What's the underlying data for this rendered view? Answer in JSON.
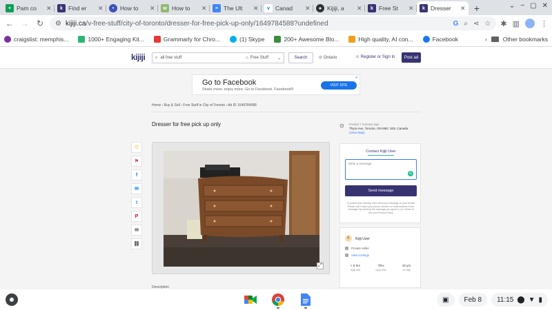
{
  "browser": {
    "tabs": [
      {
        "title": "Pam co",
        "icon": "google-sheets-icon",
        "color": "#0f9d58",
        "glyph": "+"
      },
      {
        "title": "Find er",
        "icon": "kijiji-icon",
        "color": "#373373",
        "glyph": "k"
      },
      {
        "title": "How to",
        "icon": "globe-icon",
        "color": "#4051b5",
        "glyph": "•"
      },
      {
        "title": "How to",
        "icon": "wikihow-icon",
        "color": "#93b874",
        "glyph": "w"
      },
      {
        "title": "The Ult",
        "icon": "google-docs-icon",
        "color": "#4285f4",
        "glyph": "≡"
      },
      {
        "title": "Canad",
        "icon": "vmedia-icon",
        "color": "#1a73e8",
        "glyph": "v"
      },
      {
        "title": "Kijiji, a",
        "icon": "github-icon",
        "color": "#333333",
        "glyph": "●"
      },
      {
        "title": "Free St",
        "icon": "kijiji-icon",
        "color": "#373373",
        "glyph": "k"
      },
      {
        "title": "Dresser",
        "icon": "kijiji-icon",
        "color": "#373373",
        "glyph": "k",
        "active": true
      }
    ],
    "url_host": "kijiji.ca",
    "url_path": "/v-free-stuff/city-of-toronto/dresser-for-free-pick-up-only/1649784588?undefined",
    "bookmarks": [
      {
        "label": "craigslist: memphis...",
        "icon": "craigslist-icon",
        "color": "#7b2fa1"
      },
      {
        "label": "1000+ Engaging Kit...",
        "icon": "bookmark-icon",
        "color": "#2bb673"
      },
      {
        "label": "Grammarly for Chro...",
        "icon": "grammarly-icon",
        "color": "#e53935"
      },
      {
        "label": "(1) Skype",
        "icon": "skype-icon",
        "color": "#00aff0"
      },
      {
        "label": "200+ Awesome Blo...",
        "icon": "bookmark-icon",
        "color": "#3d8c40"
      },
      {
        "label": "High quality, AI con...",
        "icon": "bookmark-icon",
        "color": "#f0a020"
      },
      {
        "label": "Facebook",
        "icon": "facebook-icon",
        "color": "#1877f2"
      }
    ],
    "other_bookmarks": "Other bookmarks"
  },
  "kijiji": {
    "logo": "kijiji",
    "search_value": "all free stuff",
    "category": "Free Stuff",
    "search_btn": "Search",
    "location": "Ontario",
    "register": "Register or Sign In",
    "post_ad": "Post ad"
  },
  "ad": {
    "title": "Go to Facebook",
    "subtitle": "Share more, enjoy more. Go to Facebook. Facebook®",
    "cta": "VISIT SITE",
    "close": "✕"
  },
  "listing": {
    "breadcrumbs": "Home › Buy & Sell › Free Stuff in City of Toronto › Ad ID 1649784588",
    "title": "Dresser for free pick up only",
    "posted": "Posted 7 minutes ago",
    "address": "Thyra Ave, Toronto, ON M6C 1E8, Canada",
    "map_link": "(View Map)",
    "description_label": "Description"
  },
  "contact": {
    "title": "Contact Kijiji User",
    "placeholder": "Write a message",
    "send": "Send message",
    "disclaimer": "To protect your identity, we'll send your message on your behalf. Please don't share your phone number or email address in the message. By sending the message you agree to our Terms of Use and Privacy Policy."
  },
  "seller": {
    "initial": "K",
    "name": "Kijiji User",
    "type": "Private seller",
    "listings_link": "View Listings",
    "stats": [
      {
        "value": "< 6 hrs",
        "label": "reply rate"
      },
      {
        "value": "75%",
        "label": "reply time"
      },
      {
        "value": "10 yrs",
        "label": "on Kijiji"
      }
    ]
  },
  "shelf": {
    "date": "Feb 8",
    "time": "11:15"
  }
}
